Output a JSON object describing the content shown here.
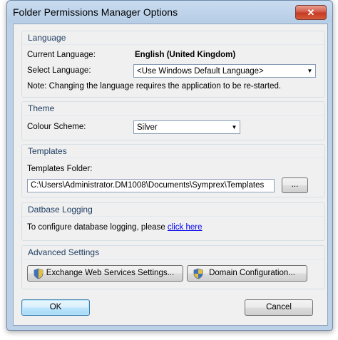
{
  "window": {
    "title": "Folder Permissions Manager Options",
    "close_glyph": "✕"
  },
  "language": {
    "group_title": "Language",
    "current_label": "Current Language:",
    "current_value": "English (United Kingdom)",
    "select_label": "Select Language:",
    "select_value": "<Use Windows Default Language>",
    "note": "Note: Changing the language requires the application to be re-started."
  },
  "theme": {
    "group_title": "Theme",
    "scheme_label": "Colour Scheme:",
    "scheme_value": "Silver"
  },
  "templates": {
    "group_title": "Templates",
    "folder_label": "Templates Folder:",
    "folder_value": "C:\\Users\\Administrator.DM1008\\Documents\\Symprex\\Templates",
    "browse_label": "..."
  },
  "logging": {
    "group_title": "Datbase Logging",
    "text": "To configure database logging, please ",
    "link": "click here"
  },
  "advanced": {
    "group_title": "Advanced Settings",
    "ews_label": "Exchange Web Services Settings...",
    "domain_label": "Domain Configuration..."
  },
  "footer": {
    "ok_label": "OK",
    "cancel_label": "Cancel"
  },
  "colors": {
    "group_title": "#1f3e63",
    "link": "#0000ee",
    "close_button": "#c23a22"
  }
}
